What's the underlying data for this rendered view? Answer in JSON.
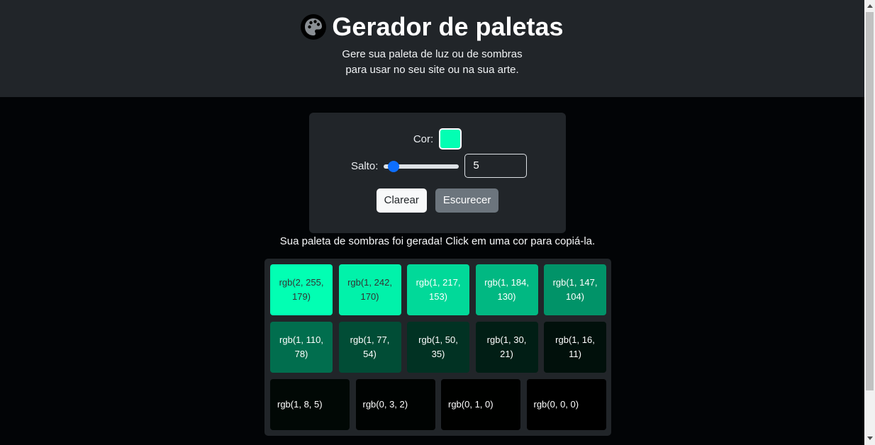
{
  "header": {
    "title": "Gerador de paletas",
    "logo_icon": "palette-icon",
    "subtitle_line1": "Gere sua paleta de luz ou de sombras",
    "subtitle_line2": "para usar no seu site ou na sua arte."
  },
  "controls": {
    "color_label": "Cor:",
    "color_value": "#02ffb3",
    "step_label": "Salto:",
    "step_value": "5",
    "step_slider_fraction": 0.04,
    "lighten_label": "Clarear",
    "darken_label": "Escurecer"
  },
  "status_message": "Sua paleta de sombras foi gerada! Click em uma cor para copiá-la.",
  "palette": [
    {
      "label": "rgb(2, 255, 179)",
      "color": "#02ffb3",
      "text_color": "#333333"
    },
    {
      "label": "rgb(1, 242, 170)",
      "color": "#01f2aa",
      "text_color": "#333333"
    },
    {
      "label": "rgb(1, 217, 153)",
      "color": "#01d999",
      "text_color": "#ffffff"
    },
    {
      "label": "rgb(1, 184, 130)",
      "color": "#01b882",
      "text_color": "#ffffff"
    },
    {
      "label": "rgb(1, 147, 104)",
      "color": "#019368",
      "text_color": "#ffffff"
    },
    {
      "label": "rgb(1, 110, 78)",
      "color": "#016e4e",
      "text_color": "#ffffff"
    },
    {
      "label": "rgb(1, 77, 54)",
      "color": "#014d36",
      "text_color": "#ffffff"
    },
    {
      "label": "rgb(1, 50, 35)",
      "color": "#013223",
      "text_color": "#ffffff"
    },
    {
      "label": "rgb(1, 30, 21)",
      "color": "#011e15",
      "text_color": "#ffffff"
    },
    {
      "label": "rgb(1, 16, 11)",
      "color": "#01100b",
      "text_color": "#ffffff"
    },
    {
      "label": "rgb(1, 8, 5)",
      "color": "#010805",
      "text_color": "#ffffff"
    },
    {
      "label": "rgb(0, 3, 2)",
      "color": "#000302",
      "text_color": "#ffffff"
    },
    {
      "label": "rgb(0, 1, 0)",
      "color": "#000100",
      "text_color": "#ffffff"
    },
    {
      "label": "rgb(0, 0, 0)",
      "color": "#000000",
      "text_color": "#ffffff"
    }
  ]
}
